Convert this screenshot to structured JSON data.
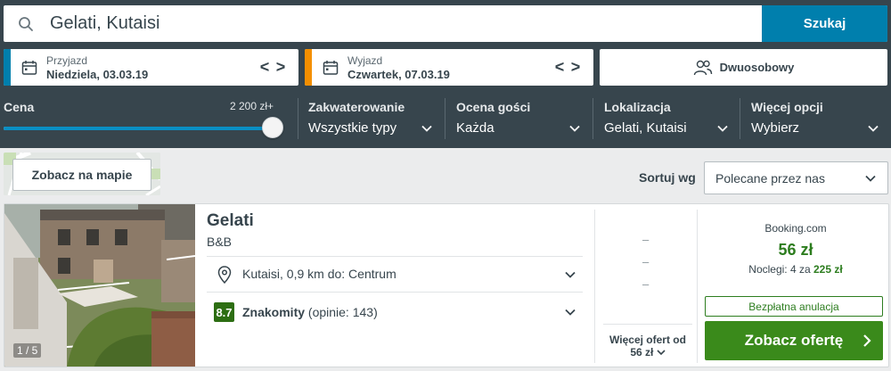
{
  "search": {
    "value": "Gelati, Kutaisi",
    "button_label": "Szukaj",
    "icon": "search-icon"
  },
  "dates": {
    "checkin": {
      "label": "Przyjazd",
      "value": "Niedziela, 03.03.19",
      "accent": "#007fad"
    },
    "checkout": {
      "label": "Wyjazd",
      "value": "Czwartek, 07.03.19",
      "accent": "#f48f00"
    },
    "prev_glyph": "<",
    "next_glyph": ">"
  },
  "room": {
    "label": "Dwuosobowy",
    "icon": "people-icon"
  },
  "filters": {
    "price": {
      "label": "Cena",
      "max_label": "2 200 zł+",
      "level": 1.0
    },
    "accommodation": {
      "label": "Zakwaterowanie",
      "value": "Wszystkie typy"
    },
    "guest_rating": {
      "label": "Ocena gości",
      "value": "Każda"
    },
    "location": {
      "label": "Lokalizacja",
      "value": "Gelati, Kutaisi"
    },
    "more": {
      "label": "Więcej opcji",
      "value": "Wybierz"
    }
  },
  "map": {
    "button_label": "Zobacz na mapie"
  },
  "sort": {
    "label": "Sortuj wg",
    "value": "Polecane przez nas"
  },
  "hotel": {
    "name": "Gelati",
    "type": "B&B",
    "photo_counter": "1 / 5",
    "location": "Kutaisi, 0,9 km do: Centrum",
    "rating_score": "8.7",
    "rating_word": "Znakomity",
    "rating_count": "(opinie: 143)",
    "rating_color": "#2d6e13",
    "placeholder_dashes": [
      "–",
      "–",
      "–"
    ],
    "more_offers_line1": "Więcej ofert od",
    "more_offers_line2": "56 zł",
    "provider": "Booking.com",
    "price": "56 zł",
    "nights_prefix": "Noclegi: 4 za",
    "nights_total": "225 zł",
    "free_cancel": "Bezpłatna anulacja",
    "deal_button": "Zobacz ofertę",
    "deal_color": "#3a8a1b"
  }
}
